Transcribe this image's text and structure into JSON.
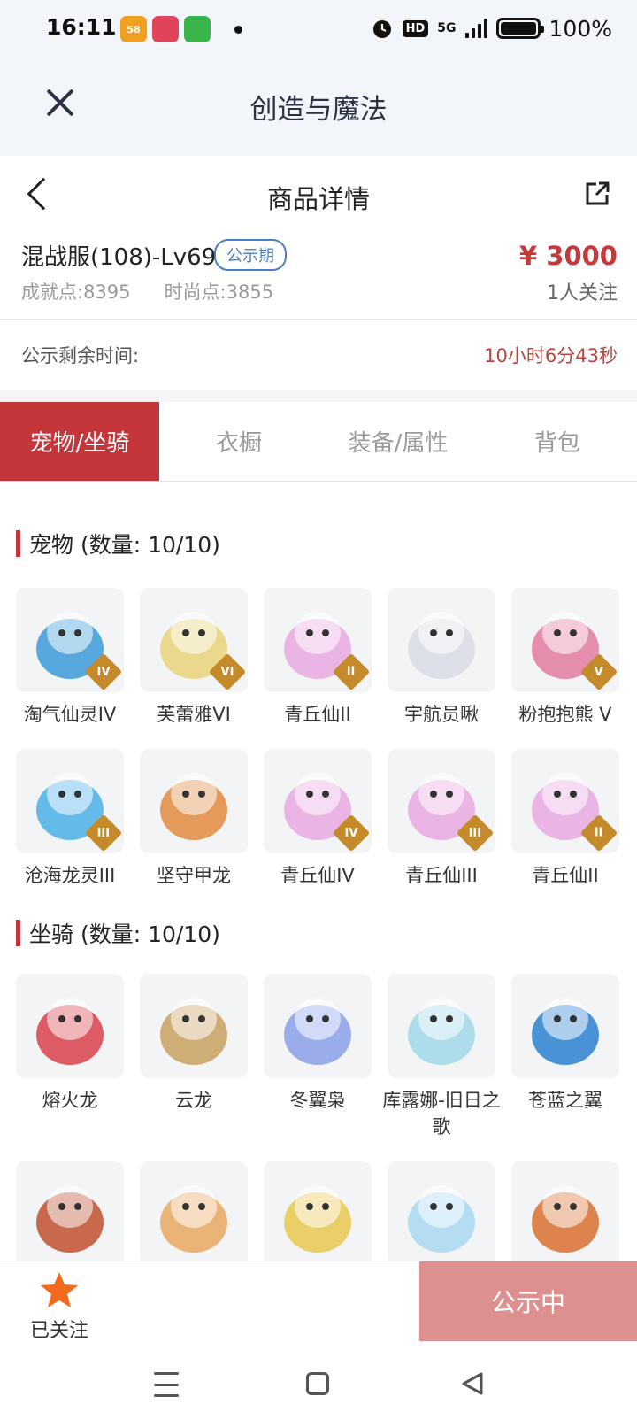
{
  "status_bar": {
    "time": "16:11",
    "app_icons": [
      {
        "name": "58-app-icon",
        "text": "58",
        "color": "#f0a020"
      },
      {
        "name": "mobile-app-icon",
        "text": "",
        "color": "#e0435a"
      },
      {
        "name": "shop-app-icon",
        "text": "",
        "color": "#39b54a"
      }
    ],
    "hd": "HD",
    "net": "5G",
    "battery": "100%",
    "battery_level": 1.0
  },
  "top_nav": {
    "title": "创造与魔法"
  },
  "detail": {
    "title": "商品详情"
  },
  "product": {
    "name": "混战服(108)-Lv69",
    "status_pill": "公示期",
    "price": "¥ 3000",
    "achievement": "成就点:8395",
    "fashion": "时尚点:3855",
    "followers": "1人关注"
  },
  "countdown": {
    "label": "公示剩余时间:",
    "value": "10小时6分43秒"
  },
  "tabs": [
    {
      "label": "宠物/坐骑",
      "active": true
    },
    {
      "label": "衣橱",
      "active": false
    },
    {
      "label": "装备/属性",
      "active": false
    },
    {
      "label": "背包",
      "active": false
    }
  ],
  "pets": {
    "title": "宠物 (数量: 10/10)",
    "items": [
      {
        "label": "淘气仙灵IV",
        "badge": "IV",
        "icon": "blue-dog-pet",
        "color": "#3a9ad8"
      },
      {
        "label": "芙蕾雅VI",
        "badge": "VI",
        "icon": "angel-girl-pet",
        "color": "#e8d27a"
      },
      {
        "label": "青丘仙II",
        "badge": "II",
        "icon": "fox-fairy-pet",
        "color": "#e8a8e0"
      },
      {
        "label": "宇航员啾",
        "badge": "",
        "icon": "astronaut-pet",
        "color": "#d8dce6"
      },
      {
        "label": "粉抱抱熊 V",
        "badge": "V",
        "icon": "pink-bear-pet",
        "color": "#e07aa0"
      },
      {
        "label": "沧海龙灵III",
        "badge": "III",
        "icon": "sea-dragon-pet",
        "color": "#4ab0e8"
      },
      {
        "label": "坚守甲龙",
        "badge": "",
        "icon": "armored-dragon-pet",
        "color": "#e08a40"
      },
      {
        "label": "青丘仙IV",
        "badge": "IV",
        "icon": "fox-fairy-pet",
        "color": "#e8a8e0"
      },
      {
        "label": "青丘仙III",
        "badge": "III",
        "icon": "fox-fairy-pet",
        "color": "#e8a8e0"
      },
      {
        "label": "青丘仙II",
        "badge": "II",
        "icon": "fox-fairy-pet",
        "color": "#e8a8e0"
      }
    ]
  },
  "mounts": {
    "title": "坐骑 (数量: 10/10)",
    "items": [
      {
        "label": "熔火龙",
        "icon": "lava-dragon-mount",
        "color": "#d8404a"
      },
      {
        "label": "云龙",
        "icon": "cloud-dragon-mount",
        "color": "#c8a060"
      },
      {
        "label": "冬翼枭",
        "icon": "winter-owl-mount",
        "color": "#8aa0e8"
      },
      {
        "label": "库露娜-旧日之歌",
        "icon": "kuluna-mount",
        "color": "#a0d8e8"
      },
      {
        "label": "苍蓝之翼",
        "icon": "azure-wing-mount",
        "color": "#2a80d0"
      },
      {
        "label": "",
        "icon": "dark-phoenix-mount",
        "color": "#c05030"
      },
      {
        "label": "",
        "icon": "cat-mount",
        "color": "#e8a860"
      },
      {
        "label": "",
        "icon": "golden-dragon-mount",
        "color": "#e8c850"
      },
      {
        "label": "",
        "icon": "spirit-maiden-mount",
        "color": "#a8d8f0"
      },
      {
        "label": "",
        "icon": "fire-bird-mount",
        "color": "#d87030"
      }
    ]
  },
  "bottom": {
    "follow_label": "已关注",
    "cta_label": "公示中",
    "accent": "#c5363a",
    "star_color": "#f26b1d"
  }
}
